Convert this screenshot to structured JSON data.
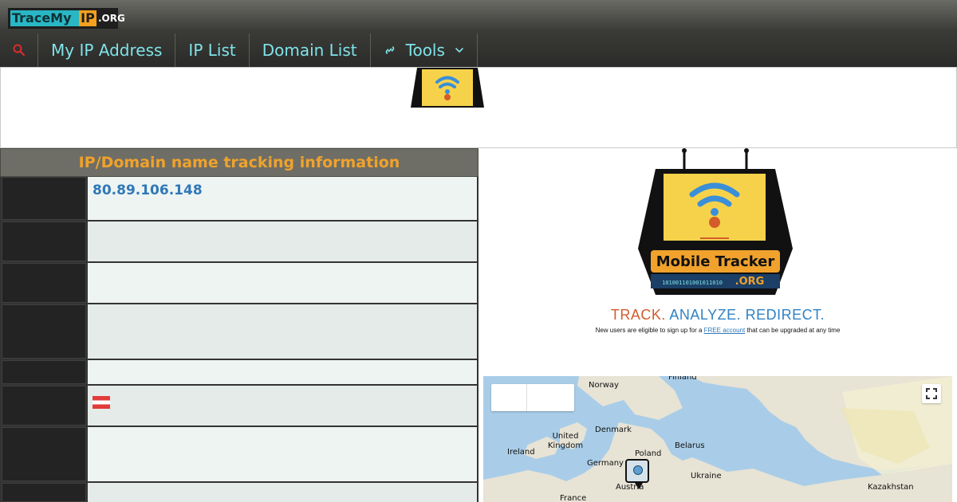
{
  "topbar": {
    "logo": {
      "part1": "TraceMy",
      "part2": "IP",
      "part3": ".ORG"
    },
    "nav": {
      "search_icon": "search-icon",
      "items": [
        {
          "label": "My IP Address"
        },
        {
          "label": "IP List"
        },
        {
          "label": "Domain List"
        },
        {
          "label": "Tools"
        }
      ],
      "tools_icon": "link-icon",
      "chevron_icon": "chevron-down-icon"
    }
  },
  "tracking": {
    "title": "IP/Domain name tracking information",
    "rows": [
      {
        "value": "80.89.106.148"
      },
      {
        "value": ""
      },
      {
        "value": ""
      },
      {
        "value": ""
      },
      {
        "value": ""
      },
      {
        "value": "",
        "flag": "austria-flag-icon"
      },
      {
        "value": ""
      },
      {
        "value": ""
      }
    ]
  },
  "promo": {
    "logo_text": "Mobile Tracker",
    "logo_code": "101001101001011010",
    "logo_domain": ".ORG",
    "tagline_words": [
      "TRACK.",
      "ANALYZE.",
      "REDIRECT."
    ],
    "sub_before": "New users are eligible to sign up for a ",
    "sub_link": "FREE account",
    "sub_after": " that can be upgraded at any time"
  },
  "map": {
    "places": [
      "Finland",
      "Norway",
      "Denmark",
      "United Kingdom",
      "Ireland",
      "Poland",
      "Belarus",
      "Germany",
      "Ukraine",
      "Austria",
      "France",
      "Kazakhstan"
    ],
    "fullscreen_icon": "fullscreen-icon",
    "marker_icon": "location-marker-icon"
  },
  "colors": {
    "accent": "#7fe3e8",
    "title": "#f0a22c",
    "ip": "#2f78b7"
  }
}
